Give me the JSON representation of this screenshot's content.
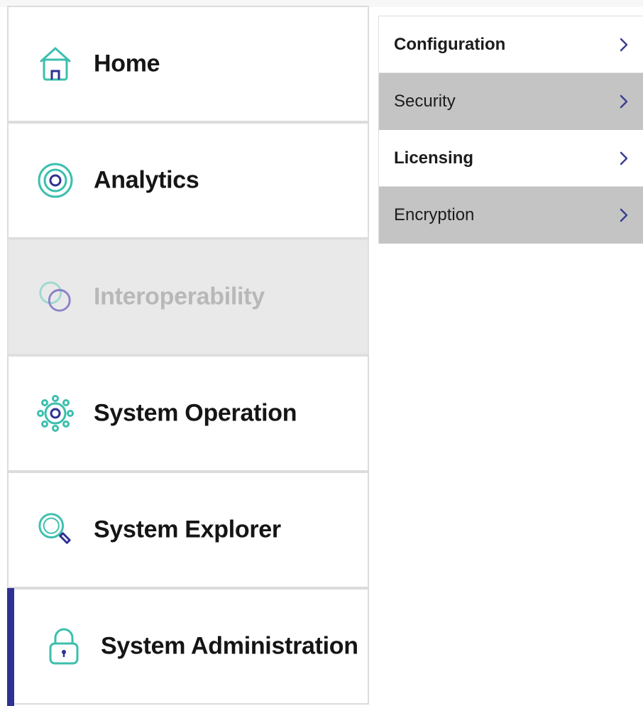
{
  "nav": {
    "items": [
      {
        "label": "Home",
        "icon": "home-icon",
        "state": "normal"
      },
      {
        "label": "Analytics",
        "icon": "target-icon",
        "state": "normal"
      },
      {
        "label": "Interoperability",
        "icon": "linked-rings-icon",
        "state": "disabled"
      },
      {
        "label": "System Operation",
        "icon": "gear-icon",
        "state": "normal"
      },
      {
        "label": "System Explorer",
        "icon": "magnifier-icon",
        "state": "normal"
      },
      {
        "label": "System Administration",
        "icon": "lock-icon",
        "state": "active"
      }
    ]
  },
  "submenu": {
    "items": [
      {
        "label": "Configuration"
      },
      {
        "label": "Security"
      },
      {
        "label": "Licensing"
      },
      {
        "label": "Encryption"
      }
    ]
  },
  "colors": {
    "accent": "#2e3192",
    "icon_teal": "#3cbfae",
    "icon_purple": "#8a83c9",
    "chevron": "#3b3f8f",
    "submenu_grey": "#c4c4c4",
    "disabled_bg": "#e9e9e9",
    "disabled_text": "#b8b8b8"
  }
}
